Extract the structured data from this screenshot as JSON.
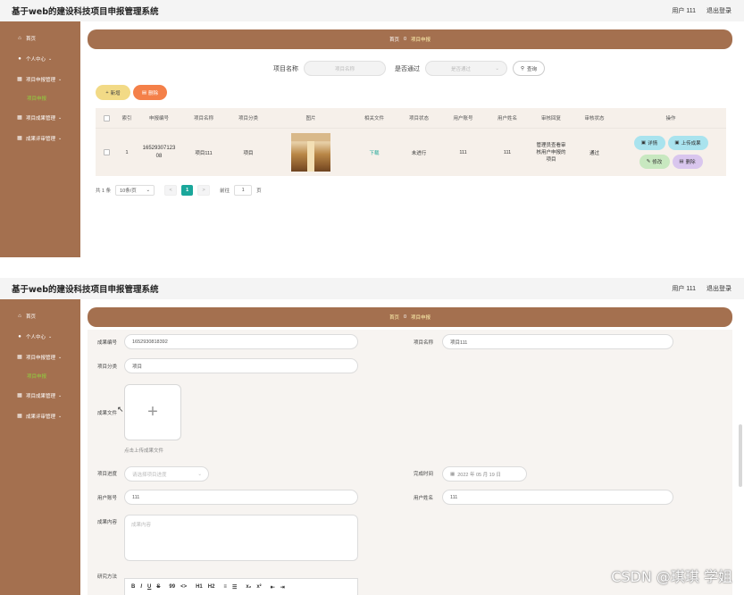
{
  "app": {
    "title": "基于web的建设科技项目申报管理系统",
    "user_label": "用户 111",
    "logout_label": "退出登录"
  },
  "sidebar": {
    "items": [
      {
        "label": "首页",
        "icon": "home-icon"
      },
      {
        "label": "个人中心",
        "icon": "user-icon"
      },
      {
        "label": "项目申报管理",
        "icon": "grid-icon"
      },
      {
        "label": "项目申报",
        "icon": ""
      },
      {
        "label": "项目成果管理",
        "icon": "grid-icon"
      },
      {
        "label": "成果评审管理",
        "icon": "grid-icon"
      }
    ]
  },
  "breadcrumb": {
    "home": "首页",
    "separator": "0",
    "current": "项目申报"
  },
  "list_view": {
    "search": {
      "name_label": "项目名称",
      "name_placeholder": "项目名称",
      "pass_label": "是否通过",
      "pass_placeholder": "是否通过",
      "query_button": "查询"
    },
    "actions": {
      "add": "新增",
      "delete": "删除"
    },
    "table": {
      "headers": [
        "索引",
        "申报编号",
        "项目名称",
        "项目分类",
        "图片",
        "相关文件",
        "项目状态",
        "用户账号",
        "用户姓名",
        "审核回复",
        "审核状态",
        "操作"
      ],
      "row": {
        "index": "1",
        "report_no": "16529307123 08",
        "project_name": "项目111",
        "category": "项目",
        "file_link": "下载",
        "status": "未进行",
        "account": "111",
        "user_name": "111",
        "reply": "管理员查看审核用户申报的项目",
        "audit_state": "通过",
        "ops": {
          "detail": "详情",
          "upload": "上传成果",
          "edit": "修改",
          "remove": "删除"
        }
      }
    },
    "pager": {
      "total": "共 1 条",
      "page_size": "10条/页",
      "prev": "<",
      "current": "1",
      "next": ">",
      "goto_prefix": "前往",
      "goto_value": "1",
      "goto_suffix": "页"
    }
  },
  "form_view": {
    "result_no": {
      "label": "成果编号",
      "value": "1652930818392"
    },
    "project_name": {
      "label": "项目名称",
      "value": "项目111"
    },
    "category": {
      "label": "项目分类",
      "value": "项目"
    },
    "result_file": {
      "label": "成果文件",
      "hint": "点击上传成果文件",
      "plus": "+"
    },
    "progress": {
      "label": "项目进度",
      "placeholder": "请选择项目进度"
    },
    "finish_time": {
      "label": "完成时间",
      "value": "2022 年 05 月 19 日"
    },
    "account": {
      "label": "用户账号",
      "value": "111"
    },
    "user_name": {
      "label": "用户姓名",
      "value": "111"
    },
    "content": {
      "label": "成果内容",
      "placeholder": "成果内容"
    },
    "method": {
      "label": "研究方法"
    },
    "editor_toolbar": [
      "B",
      "I",
      "U",
      "S",
      "99",
      "<>",
      "H1",
      "H2",
      "≡",
      "☰",
      "x₂",
      "x²",
      "⇤",
      "⇥"
    ]
  },
  "watermark": "CSDN @琪琪 学姐",
  "colors": {
    "brand_brown": "#a4704f",
    "accent_green": "#8fd23e",
    "pager_teal": "#1aa79b",
    "add_yellow": "#f2da86",
    "delete_orange": "#f48049"
  }
}
